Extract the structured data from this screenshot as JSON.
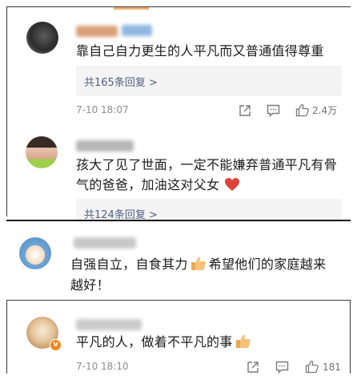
{
  "colors": {
    "link": "#506082",
    "meta": "#8c8c8c",
    "text": "#1b1b1b",
    "heart": "#e0423a"
  },
  "comments": [
    {
      "text": "靠自己自力更生的人平凡而又普通值得尊重",
      "reply_link": "共165条回复 >",
      "time": "7-10 18:07",
      "likes": "2.4万"
    },
    {
      "text_line1": "孩大了见了世面，一定不能嫌弃普通平凡有骨",
      "text_line2": "气的爸爸，加油这对父女",
      "reply_link": "共124条回复 >"
    },
    {
      "text_line1": "自强自立，自食其力",
      "text_line1b": "希望他们的家庭越来",
      "text_line2": "越好！"
    },
    {
      "text": "平凡的人，做着不平凡的事",
      "time": "7-10 18:10",
      "likes": "181"
    }
  ],
  "icons": [
    "share-icon",
    "comment-icon",
    "like-icon",
    "thumbs-up-emoji-icon",
    "heart-emoji-icon",
    "verified-badge-icon"
  ]
}
